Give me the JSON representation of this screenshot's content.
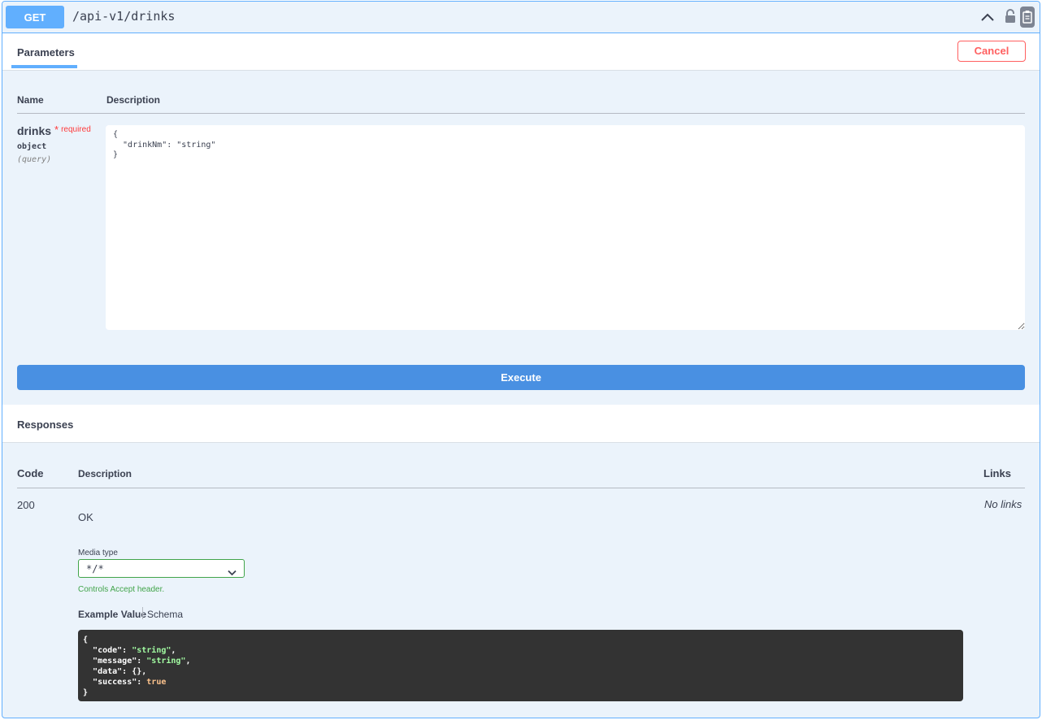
{
  "operation": {
    "method": "GET",
    "path": "/api-v1/drinks"
  },
  "tabs": {
    "parameters_label": "Parameters",
    "cancel_label": "Cancel"
  },
  "parameters": {
    "col_name": "Name",
    "col_description": "Description",
    "items": [
      {
        "name": "drinks",
        "required_star": "*",
        "required_label": "required",
        "type": "object",
        "in": "(query)",
        "value": "{\n  \"drinkNm\": \"string\"\n}"
      }
    ]
  },
  "execute_label": "Execute",
  "responses": {
    "title": "Responses",
    "col_code": "Code",
    "col_description": "Description",
    "col_links": "Links",
    "rows": [
      {
        "code": "200",
        "description": "OK",
        "links": "No links",
        "media_type_label": "Media type",
        "media_type_value": "*/*",
        "controls_text": "Controls Accept header.",
        "example_tab": "Example Value",
        "schema_tab": "Schema",
        "example": {
          "open": "{",
          "close": "}",
          "lines": [
            {
              "key": "\"code\"",
              "value": "\"string\"",
              "kind": "string",
              "comma": ","
            },
            {
              "key": "\"message\"",
              "value": "\"string\"",
              "kind": "string",
              "comma": ","
            },
            {
              "key": "\"data\"",
              "value": "{}",
              "kind": "plain",
              "comma": ","
            },
            {
              "key": "\"success\"",
              "value": "true",
              "kind": "bool",
              "comma": ""
            }
          ]
        }
      }
    ]
  },
  "colors": {
    "get_accent": "#61affe",
    "execute": "#4990e2",
    "cancel": "#ff6060",
    "required": "#ff3b3b",
    "media_border": "#41a44a",
    "code_bg": "#333333"
  },
  "icons": {
    "collapse": "chevron-up-icon",
    "authorize": "lock-icon",
    "copy": "clipboard-icon",
    "select": "chevron-down-icon"
  }
}
